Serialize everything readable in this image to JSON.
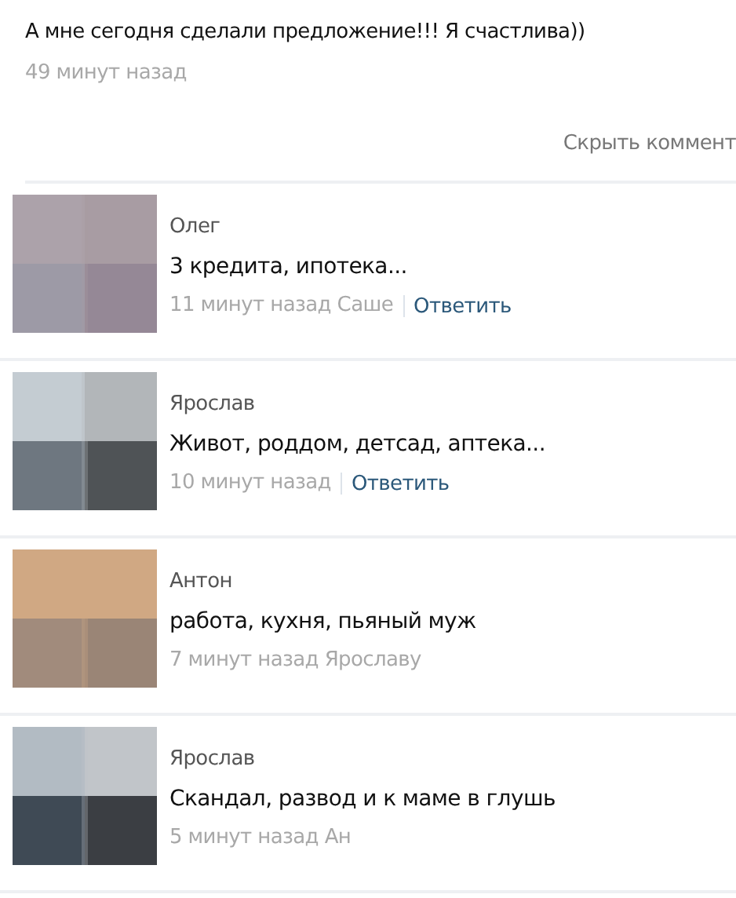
{
  "post": {
    "text": "А мне сегодня сделали предложение!!! Я счастлива))",
    "time": "49 минут назад"
  },
  "hide_link": "Скрыть коммент",
  "comments": [
    {
      "kind": "picture",
      "author": "Олег",
      "text": "3 кредита, ипотека...",
      "meta": "11 минут назад Саше",
      "reply_link": "Ответить"
    },
    {
      "kind": "picture",
      "author": "Ярослав",
      "text": "Живот, роддом, детсад, аптека...",
      "meta": "10 минут назад",
      "reply_link": "Ответить"
    },
    {
      "kind": "picture",
      "author": "Антон",
      "text": "работа, кухня, пьяный муж",
      "meta": "7 минут назад Ярославу"
    },
    {
      "kind": "picture",
      "author": "Ярослав",
      "text": "Скандал, развод и к маме в глушь",
      "meta": "5 минут назад Ан"
    }
  ]
}
